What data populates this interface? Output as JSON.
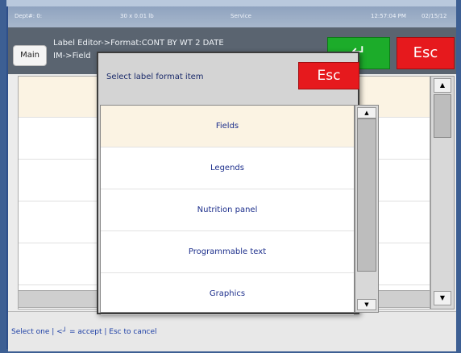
{
  "status_bar": {
    "dept": "Dept#: 0:",
    "weight": "30 x 0.01 lb",
    "mode": "Service",
    "time": "12:57:04 PM",
    "date": "02/15/12"
  },
  "header": {
    "main_label": "Main",
    "line1": "Label Editor->Format:CONT BY WT 2 DATE",
    "line2": "IM->Field",
    "accept_label": "↵",
    "esc_label": "Esc"
  },
  "dialog": {
    "title": "Select label format item",
    "esc_label": "Esc",
    "items": [
      {
        "label": "Fields",
        "selected": true
      },
      {
        "label": "Legends",
        "selected": false
      },
      {
        "label": "Nutrition panel",
        "selected": false
      },
      {
        "label": "Programmable text",
        "selected": false
      },
      {
        "label": "Graphics",
        "selected": false
      }
    ],
    "scroll_up": "▲",
    "scroll_down": "▼"
  },
  "background_list": {
    "scroll_up": "▲",
    "scroll_down": "▼"
  },
  "footer": {
    "hint": "Select one | <┘ = accept | Esc to cancel"
  },
  "colors": {
    "accept": "#1cac2a",
    "escape": "#e6191d",
    "selected_row": "#fbf3e3",
    "text_blue": "#1d2f8c"
  }
}
